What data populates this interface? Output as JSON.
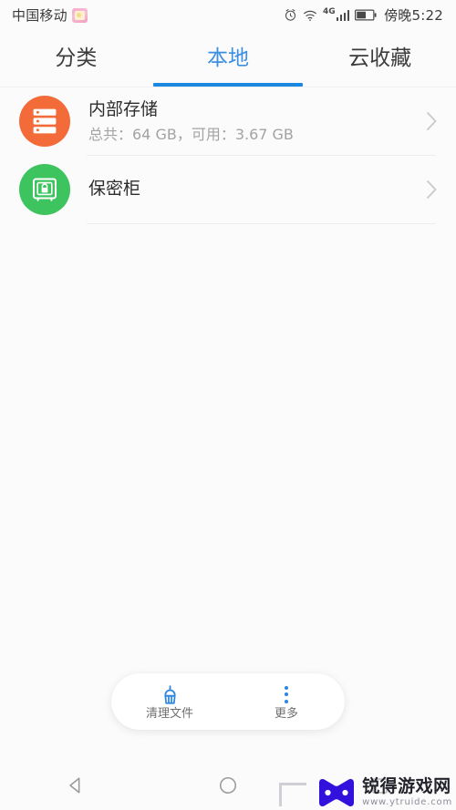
{
  "status_bar": {
    "carrier": "中国移动",
    "sim_badge_icon": "sim-card-badge-icon",
    "alarm_icon": "alarm-clock-icon",
    "wifi_icon": "wifi-icon",
    "network_label": "4G",
    "signal_icon": "signal-bars-icon",
    "battery_icon": "battery-icon",
    "time": "傍晚5:22"
  },
  "tabs": [
    {
      "label": "分类",
      "active": false,
      "name": "tab-categories"
    },
    {
      "label": "本地",
      "active": true,
      "name": "tab-local"
    },
    {
      "label": "云收藏",
      "active": false,
      "name": "tab-cloud-favorites"
    }
  ],
  "list": [
    {
      "title": "内部存储",
      "subtitle": "总共：64 GB，可用：3.67 GB",
      "icon": "internal-storage-icon",
      "icon_color": "#F26B38",
      "chevron_icon": "chevron-right-icon"
    },
    {
      "title": "保密柜",
      "subtitle": "",
      "icon": "safe-vault-lock-icon",
      "icon_color": "#3DC45F",
      "chevron_icon": "chevron-right-icon"
    }
  ],
  "toolbar": {
    "clean_label": "清理文件",
    "clean_icon": "broom-icon",
    "more_label": "更多",
    "more_icon": "more-vertical-dots-icon",
    "accent_color": "#2B86E0"
  },
  "nav_bar": {
    "back_icon": "back-triangle-icon",
    "home_icon": "home-circle-icon",
    "recents_icon": "recents-square-icon"
  },
  "watermark": {
    "brand": "锐得游戏网",
    "url": "www.ytruide.com",
    "logo_icon": "bowtie-logo-icon",
    "logo_color": "#3311DD"
  }
}
